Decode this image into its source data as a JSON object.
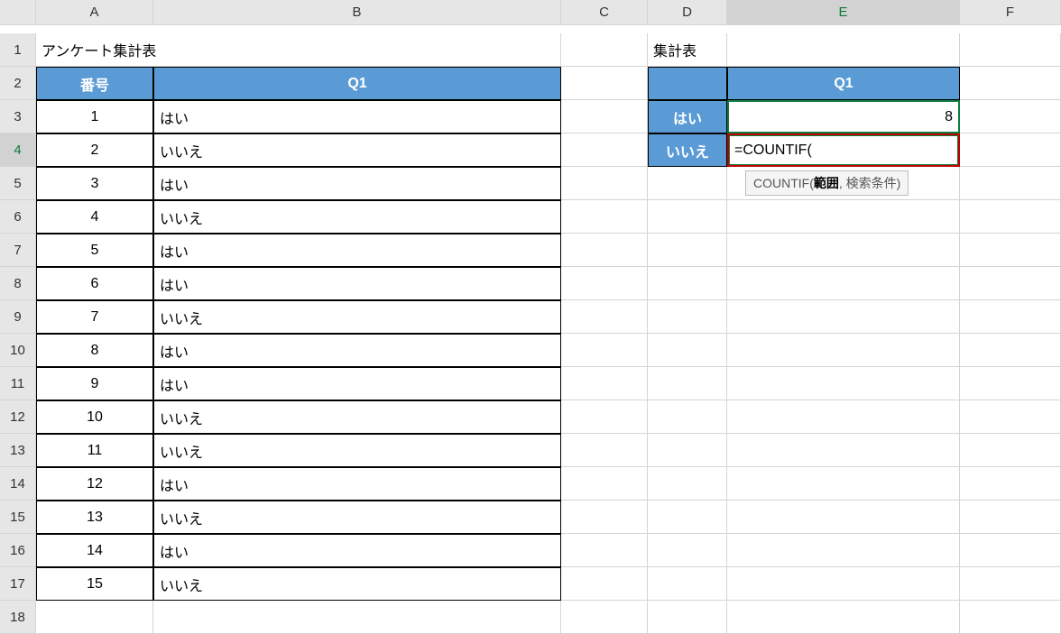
{
  "columns": [
    "A",
    "B",
    "C",
    "D",
    "E",
    "F"
  ],
  "rows": [
    "1",
    "2",
    "3",
    "4",
    "5",
    "6",
    "7",
    "8",
    "9",
    "10",
    "11",
    "12",
    "13",
    "14",
    "15",
    "16",
    "17",
    "18"
  ],
  "title_a1": "アンケート集計表",
  "title_d1": "集計表",
  "headers_main": {
    "a2": "番号",
    "b2": "Q1"
  },
  "headers_summary": {
    "d2": "",
    "e2": "Q1"
  },
  "summary_labels": {
    "d3": "はい",
    "d4": "いいえ"
  },
  "summary_values": {
    "e3": "8",
    "e4": "=COUNTIF("
  },
  "tooltip": {
    "func": "COUNTIF(",
    "arg_bold": "範囲",
    "rest": ", 検索条件)"
  },
  "data_rows": [
    {
      "num": "1",
      "ans": "はい"
    },
    {
      "num": "2",
      "ans": "いいえ"
    },
    {
      "num": "3",
      "ans": "はい"
    },
    {
      "num": "4",
      "ans": "いいえ"
    },
    {
      "num": "5",
      "ans": "はい"
    },
    {
      "num": "6",
      "ans": "はい"
    },
    {
      "num": "7",
      "ans": "いいえ"
    },
    {
      "num": "8",
      "ans": "はい"
    },
    {
      "num": "9",
      "ans": "はい"
    },
    {
      "num": "10",
      "ans": "いいえ"
    },
    {
      "num": "11",
      "ans": "いいえ"
    },
    {
      "num": "12",
      "ans": "はい"
    },
    {
      "num": "13",
      "ans": "いいえ"
    },
    {
      "num": "14",
      "ans": "はい"
    },
    {
      "num": "15",
      "ans": "いいえ"
    }
  ],
  "chart_data": {
    "type": "table",
    "title": "アンケート集計表",
    "columns": [
      "番号",
      "Q1"
    ],
    "rows": [
      [
        1,
        "はい"
      ],
      [
        2,
        "いいえ"
      ],
      [
        3,
        "はい"
      ],
      [
        4,
        "いいえ"
      ],
      [
        5,
        "はい"
      ],
      [
        6,
        "はい"
      ],
      [
        7,
        "いいえ"
      ],
      [
        8,
        "はい"
      ],
      [
        9,
        "はい"
      ],
      [
        10,
        "いいえ"
      ],
      [
        11,
        "いいえ"
      ],
      [
        12,
        "はい"
      ],
      [
        13,
        "いいえ"
      ],
      [
        14,
        "はい"
      ],
      [
        15,
        "いいえ"
      ]
    ],
    "summary": {
      "title": "集計表",
      "Q1": {
        "はい": 8,
        "いいえ": null
      }
    }
  }
}
